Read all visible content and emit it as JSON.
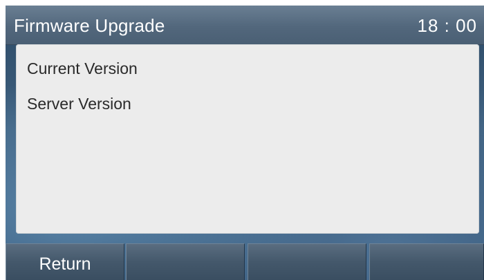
{
  "header": {
    "title": "Firmware Upgrade",
    "clock": "18 : 00"
  },
  "content": {
    "items": [
      {
        "label": "Current Version"
      },
      {
        "label": "Server Version"
      }
    ]
  },
  "softkeys": [
    {
      "label": "Return"
    },
    {
      "label": ""
    },
    {
      "label": ""
    },
    {
      "label": ""
    }
  ]
}
